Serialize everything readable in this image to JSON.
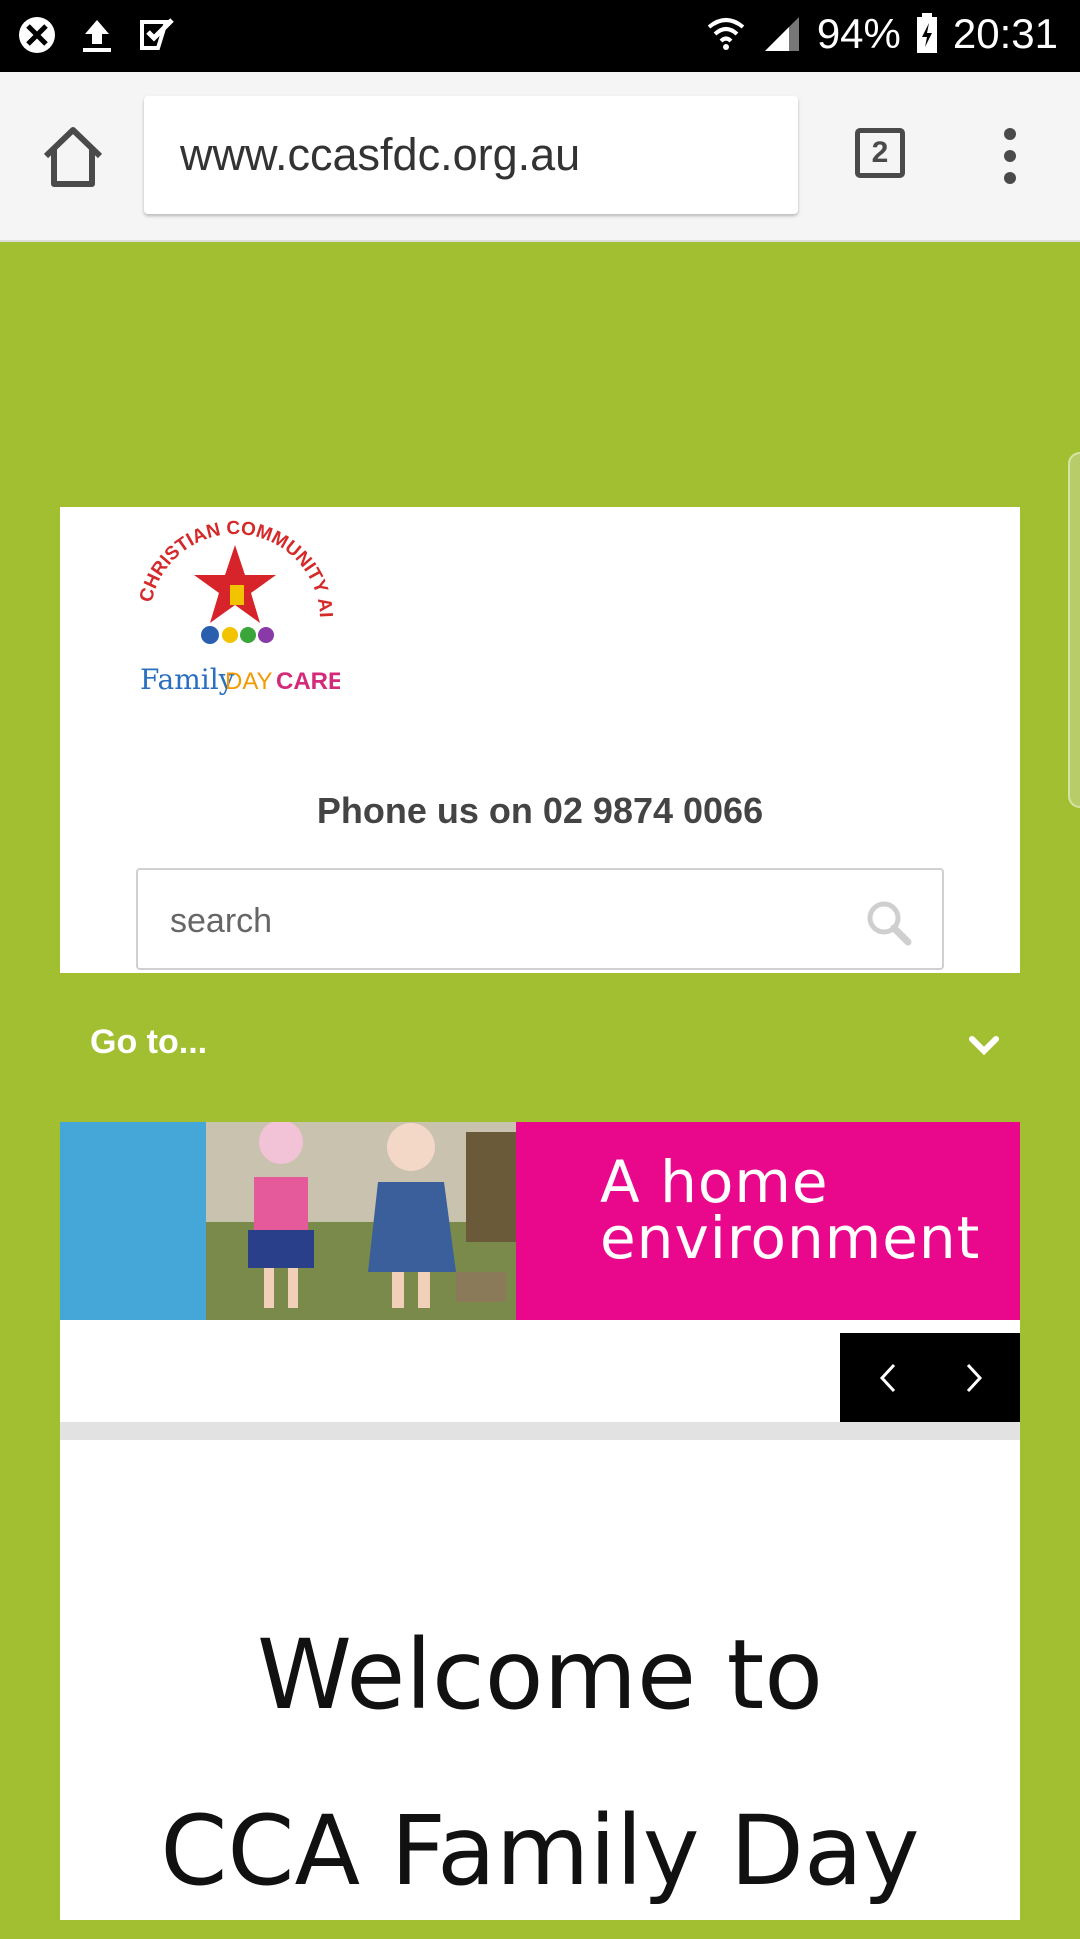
{
  "status_bar": {
    "battery": "94%",
    "time": "20:31",
    "icons": [
      "blocked-notification-icon",
      "upload-icon",
      "task-check-icon",
      "wifi-icon",
      "signal-icon",
      "battery-charging-icon"
    ]
  },
  "browser": {
    "url": "www.ccasfdc.org.au",
    "tab_count": "2",
    "icons": [
      "home-icon",
      "tabs-icon",
      "overflow-menu-icon"
    ]
  },
  "header": {
    "logo_text": {
      "arc": "CHRISTIAN COMMUNITY AID",
      "family": "Family",
      "day": "DAY",
      "care": "CARE"
    },
    "phone_text": "Phone us on 02 9874 0066"
  },
  "search": {
    "placeholder": "search"
  },
  "nav": {
    "goto_label": "Go to..."
  },
  "banner": {
    "text_line1": "A home",
    "text_line2": "environment"
  },
  "slider": {
    "prev_symbol": "‹",
    "next_symbol": "›"
  },
  "welcome": {
    "line1": "Welcome to",
    "line2": "CCA Family Day"
  },
  "colors": {
    "page_green": "#a2bf31",
    "banner_blue": "#45a7d7",
    "banner_pink": "#e9088c"
  }
}
